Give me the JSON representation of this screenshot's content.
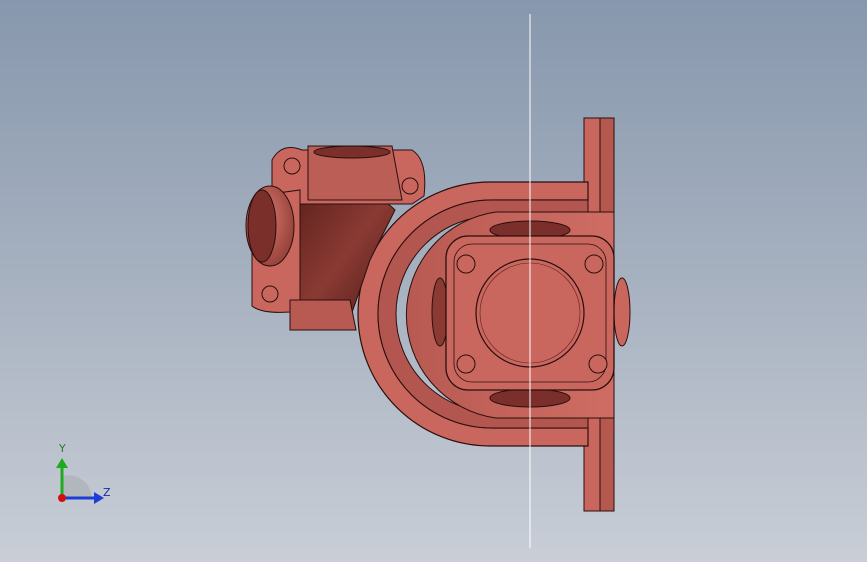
{
  "viewport": {
    "background_top": "#8797ad",
    "background_bottom": "#c9ced7"
  },
  "model": {
    "part_color": "#c9675f",
    "part_dark": "#7a2f2a",
    "part_shadow": "#5b1f1b",
    "edge_color": "#2a0f0c",
    "section_line_color": "#ffffff"
  },
  "triad": {
    "y_label": "Y",
    "z_label": "Z",
    "y_color": "#1faa1f",
    "z_color": "#1d3dd6",
    "x_color": "#d01010",
    "icon": "view-orientation-triad-icon"
  }
}
